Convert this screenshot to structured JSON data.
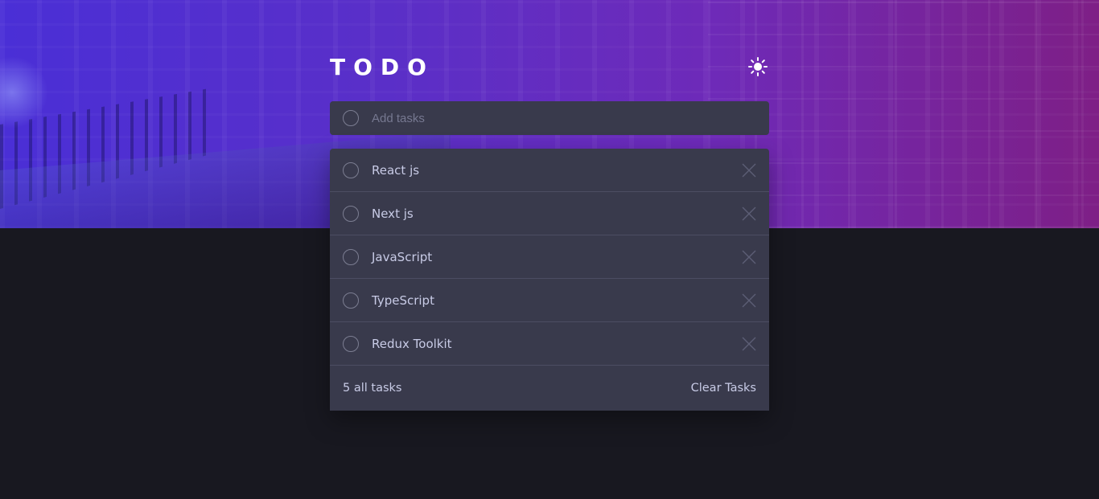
{
  "header": {
    "title": "TODO",
    "theme_toggle_icon": "sun-icon"
  },
  "new_task": {
    "placeholder": "Add tasks",
    "value": ""
  },
  "tasks": [
    {
      "label": "React js",
      "completed": false
    },
    {
      "label": "Next js",
      "completed": false
    },
    {
      "label": "JavaScript",
      "completed": false
    },
    {
      "label": "TypeScript",
      "completed": false
    },
    {
      "label": "Redux Toolkit",
      "completed": false
    }
  ],
  "footer": {
    "count_label": "5 all tasks",
    "clear_label": "Clear Tasks"
  },
  "colors": {
    "background": "#181820",
    "card": "#393a4c",
    "text": "#c8cbe6",
    "gradient_start": "#4a2fd6",
    "gradient_end": "#7e1f86"
  }
}
